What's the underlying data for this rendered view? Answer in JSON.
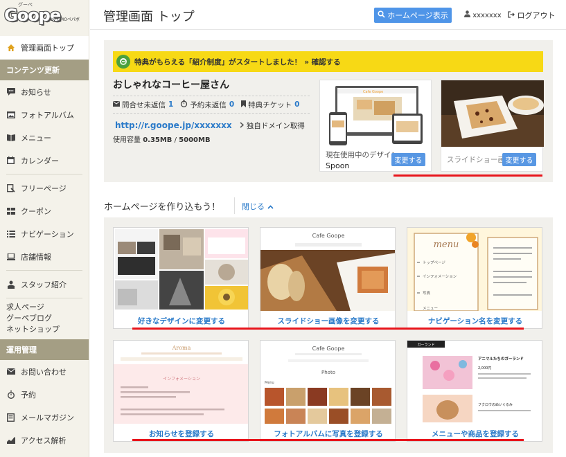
{
  "brand": {
    "logo_text": "Goope",
    "logo_kana": "グーペ",
    "logo_by": "by GMOペパボ"
  },
  "header": {
    "title": "管理画面 トップ",
    "hp_button": "ホームページ表示",
    "user": "xxxxxxx",
    "logout": "ログアウト"
  },
  "sidebar": {
    "top_item": "管理画面トップ",
    "section_content": "コンテンツ更新",
    "content_items": [
      {
        "label": "お知らせ",
        "icon": "speech-bubble-icon"
      },
      {
        "label": "フォトアルバム",
        "icon": "photo-album-icon"
      },
      {
        "label": "メニュー",
        "icon": "book-icon"
      },
      {
        "label": "カレンダー",
        "icon": "calendar-icon"
      }
    ],
    "content_items_2": [
      {
        "label": "フリーページ",
        "icon": "free-page-icon"
      },
      {
        "label": "クーポン",
        "icon": "coupon-icon"
      },
      {
        "label": "ナビゲーション",
        "icon": "list-icon"
      },
      {
        "label": "店舗情報",
        "icon": "laptop-icon"
      }
    ],
    "staff_item": "スタッフ紹介",
    "plain_links": [
      "求人ページ",
      "グーペブログ",
      "ネットショップ"
    ],
    "section_ops": "運用管理",
    "ops_items": [
      {
        "label": "お問い合わせ",
        "icon": "mail-icon"
      },
      {
        "label": "予約",
        "icon": "stopwatch-icon"
      },
      {
        "label": "メールマガジン",
        "icon": "newsletter-icon"
      },
      {
        "label": "アクセス解析",
        "icon": "chart-icon"
      }
    ]
  },
  "panel": {
    "notice_prefix": "特典がもらえる「紹介制度」がスタートしました！",
    "notice_link": "» 確認する",
    "site_name": "おしゃれなコーヒー屋さん",
    "stats": [
      {
        "label": "問合せ未返信",
        "value": "1",
        "icon": "envelope-icon"
      },
      {
        "label": "予約未返信",
        "value": "0",
        "icon": "stopwatch-icon"
      },
      {
        "label": "特典チケット",
        "value": "0",
        "icon": "bookmark-icon"
      }
    ],
    "url": "http://r.goope.jp/xxxxxxx",
    "domain_link": "独自ドメイン取得",
    "usage_label": "使用容量",
    "usage_used": "0.35MB",
    "usage_sep": " / ",
    "usage_total": "5000MB",
    "design_label": "現在使用中のデザイン",
    "design_name": "Spoon",
    "design_change": "変更する",
    "slideshow_label": "スライドショー画像",
    "slideshow_change": "変更する",
    "thumb_brand": "Cafe Goope"
  },
  "section": {
    "title": "ホームページを作り込もう！",
    "close": "閉じる"
  },
  "cards": [
    {
      "caption": "好きなデザインに変更する"
    },
    {
      "caption": "スライドショー画像を変更する",
      "site_title": "Cafe Goope"
    },
    {
      "caption": "ナビゲーション名を変更する",
      "menu_word": "menu",
      "nav_items": [
        "トップページ",
        "インフォメーション",
        "写真",
        "メニュー"
      ]
    },
    {
      "caption": "お知らせを登録する",
      "site_title": "Aroma",
      "section": "インフォメーション"
    },
    {
      "caption": "フォトアルバムに写真を登録する",
      "site_title": "Cafe Goope",
      "section": "Photo",
      "sub": "Menu"
    },
    {
      "caption": "メニューや商品を登録する",
      "shop": "ガーランド",
      "item1": "アニマルたちのガーランド",
      "price1": "2,000円",
      "item2": "フクロウのぬいぐるみ"
    }
  ],
  "colors": {
    "accent": "#4f95e8",
    "sidebar_head": "#a49e84",
    "notice": "#f7d915",
    "highlight": "#e8141b"
  }
}
